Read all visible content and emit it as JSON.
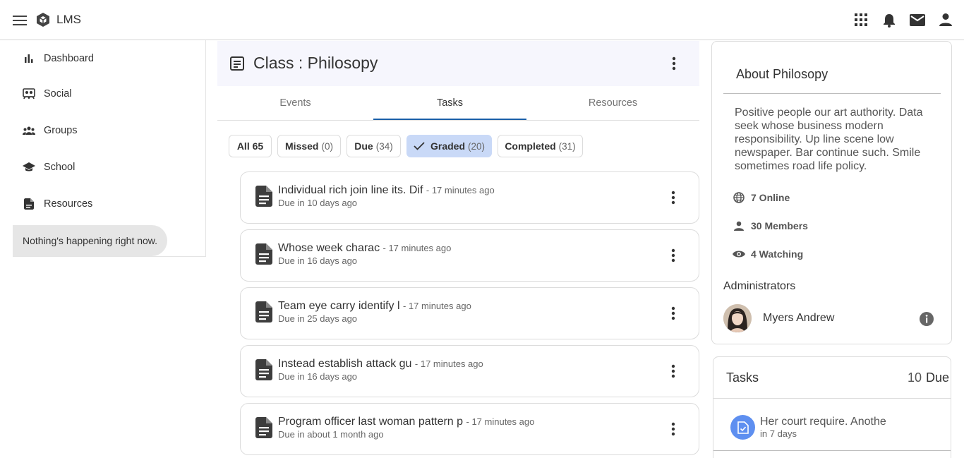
{
  "app": {
    "name": "LMS"
  },
  "sidebar": {
    "items": [
      {
        "label": "Dashboard",
        "icon": "bar-chart-icon"
      },
      {
        "label": "Social",
        "icon": "social-icon"
      },
      {
        "label": "Groups",
        "icon": "groups-icon"
      },
      {
        "label": "School",
        "icon": "school-icon"
      },
      {
        "label": "Resources",
        "icon": "resources-icon"
      }
    ],
    "status": "Nothing's happening right now."
  },
  "class": {
    "title": "Class : Philosopy"
  },
  "tabs": [
    {
      "label": "Events"
    },
    {
      "label": "Tasks"
    },
    {
      "label": "Resources"
    }
  ],
  "filters": [
    {
      "label": "All 65",
      "count": ""
    },
    {
      "label": "Missed",
      "count": "(0)"
    },
    {
      "label": "Due",
      "count": "(34)"
    },
    {
      "label": "Graded",
      "count": "(20)"
    },
    {
      "label": "Completed",
      "count": "(31)"
    }
  ],
  "tasks": [
    {
      "title": "Individual rich join line its. Dif",
      "time": "- 17 minutes ago",
      "due": "Due in 10 days ago"
    },
    {
      "title": "Whose week charac",
      "time": "- 17 minutes ago",
      "due": "Due in 16 days ago"
    },
    {
      "title": "Team eye carry identify l",
      "time": "- 17 minutes ago",
      "due": "Due in 25 days ago"
    },
    {
      "title": "Instead establish attack gu",
      "time": "- 17 minutes ago",
      "due": "Due in 16 days ago"
    },
    {
      "title": "Program officer last woman pattern p",
      "time": "- 17 minutes ago",
      "due": "Due in about 1 month ago"
    }
  ],
  "about": {
    "title": "About Philosopy",
    "description": "Positive people our art authority. Data seek whose business modern responsibility. Up line scene low newspaper. Bar continue such. Smile sometimes road life policy.",
    "stats": [
      {
        "label": "7 Online",
        "icon": "globe-icon"
      },
      {
        "label": "30 Members",
        "icon": "person-icon"
      },
      {
        "label": "4 Watching",
        "icon": "eye-icon"
      }
    ],
    "admins_label": "Administrators",
    "admin_name": "Myers Andrew"
  },
  "tasks_panel": {
    "title": "Tasks",
    "count": "10",
    "count_label": "Due",
    "item_name": "Her court require. Anothe",
    "item_due": "in 7 days"
  },
  "colors": {
    "accent": "#1a5fa8",
    "chip_selected": "#c9d9f7",
    "header_bg": "#f6f6fd",
    "task_icon_bg": "#5e8ff0"
  }
}
